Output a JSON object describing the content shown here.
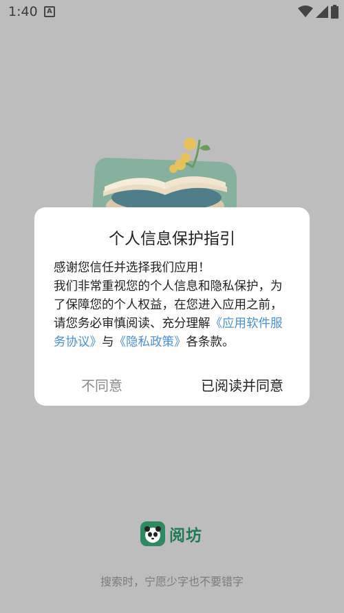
{
  "status_bar": {
    "time": "1:40",
    "notification_icon": "a-icon",
    "icons": [
      "wifi-icon",
      "signal-icon",
      "battery-icon"
    ]
  },
  "dialog": {
    "title": "个人信息保护指引",
    "line1": "感谢您信任并选择我们应用！",
    "line2": "我们非常重视您的个人信息和隐私保护，为了保障您的个人权益，在您进入应用之前，请您务必审慎阅读、充分理解",
    "link_service": "《应用软件服务协议》",
    "connector": "与",
    "link_privacy": "《隐私政策》",
    "suffix": "各条款。",
    "disagree_label": "不同意",
    "agree_label": "已阅读并同意"
  },
  "brand": {
    "name": "阅坊",
    "slogan": "搜索时，宁愿少字也不要错字"
  },
  "colors": {
    "link": "#4a90d9",
    "brand": "#1f7a56",
    "overlay": "#bdbdbd"
  }
}
